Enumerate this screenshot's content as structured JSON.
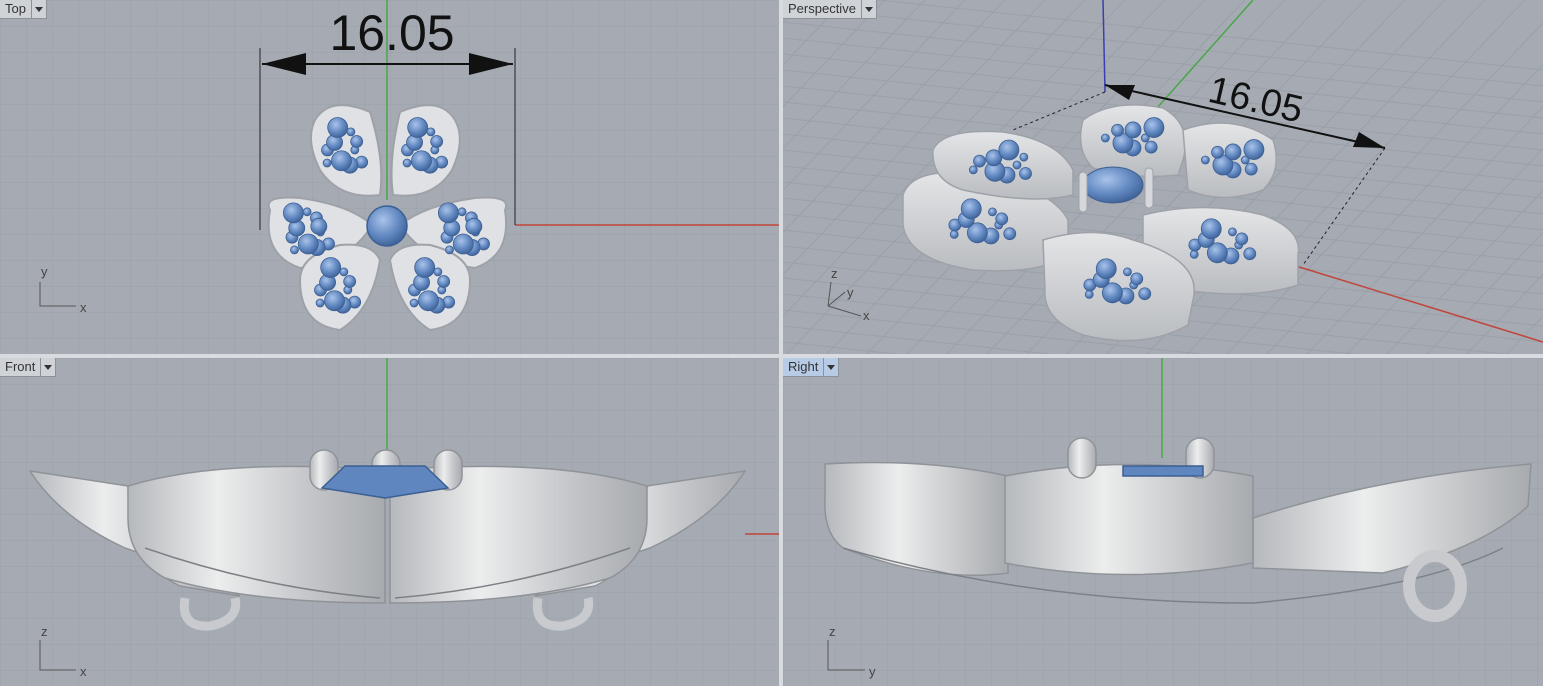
{
  "viewports": {
    "top": {
      "label": "Top"
    },
    "perspective": {
      "label": "Perspective"
    },
    "front": {
      "label": "Front"
    },
    "right": {
      "label": "Right"
    }
  },
  "dimension": "16.05",
  "axes": {
    "top": {
      "a": "y",
      "b": "x"
    },
    "perspective": {
      "a": "z",
      "b": "y",
      "c": "x"
    },
    "front": {
      "a": "z",
      "b": "x"
    },
    "right": {
      "a": "z",
      "b": "y"
    }
  },
  "colors": {
    "background": "#a6abb3",
    "grid": "#9aa0a8",
    "x_axis": "#c0453d",
    "y_axis": "#4aa64a",
    "z_axis": "#3a3fb0",
    "metal": "#d5d7da",
    "gem": "#5f86bf",
    "active_tab": "#b8cbe6"
  }
}
